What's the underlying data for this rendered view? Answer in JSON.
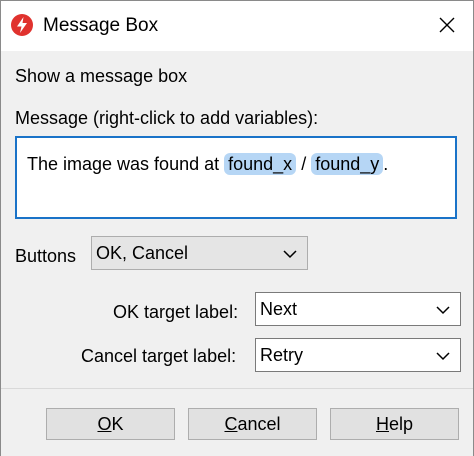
{
  "window": {
    "title": "Message Box",
    "icon": "lightning-icon",
    "close_icon": "close-icon"
  },
  "content": {
    "action_label": "Show a message box",
    "message_label": "Message (right-click to add variables):",
    "message": {
      "prefix": "The image was found at ",
      "var1": "found_x",
      "separator": " / ",
      "var2": "found_y",
      "suffix": "."
    },
    "buttons_label": "Buttons",
    "buttons_value": "OK, Cancel",
    "ok_target_label": "OK target label:",
    "ok_target_value": "Next",
    "cancel_target_label": "Cancel target label:",
    "cancel_target_value": "Retry"
  },
  "footer": {
    "ok": {
      "mnemonic": "O",
      "rest": "K"
    },
    "cancel": {
      "mnemonic": "C",
      "rest": "ancel"
    },
    "help": {
      "mnemonic": "H",
      "rest": "elp"
    }
  },
  "colors": {
    "accent": "#1a73c8",
    "icon_red": "#e0322e",
    "variable_chip": "#b6d6f5"
  }
}
